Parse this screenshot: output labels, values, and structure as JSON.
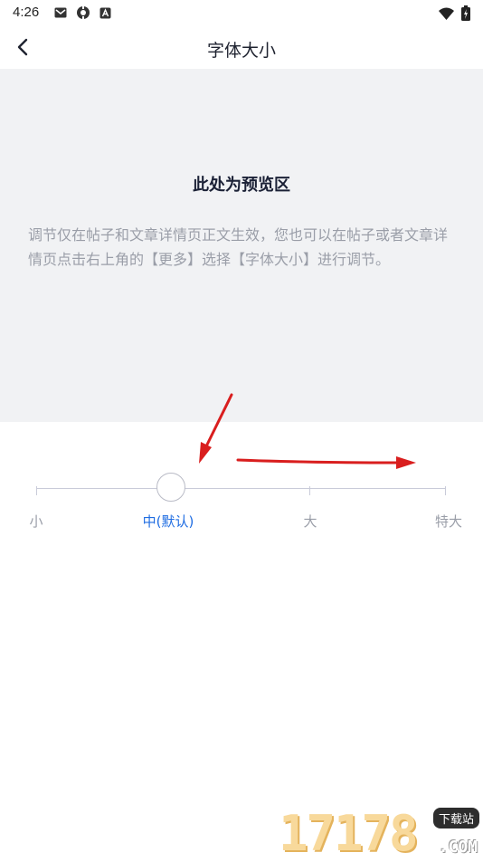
{
  "status_bar": {
    "time": "4:26",
    "left_icons": [
      "gmail-icon",
      "settings-shield-icon",
      "a-badge-icon"
    ],
    "right_icons": [
      "wifi-icon",
      "battery-charging-icon"
    ]
  },
  "app_bar": {
    "back_icon": "chevron-left-icon",
    "title": "字体大小"
  },
  "preview": {
    "heading": "此处为预览区",
    "body": "调节仅在帖子和文章详情页正文生效，您也可以在帖子或者文章详情页点击右上角的【更多】选择【字体大小】进行调节。"
  },
  "font_size_slider": {
    "options": [
      "小",
      "中(默认)",
      "大",
      "特大"
    ],
    "selected_index": 1,
    "active_color": "#1f6de2",
    "track_color": "#c9cbd9"
  },
  "annotation": {
    "arrow_color": "#d91e1e"
  },
  "watermark": {
    "number": "17178",
    "badge": "下载站",
    "domain": ".COM"
  }
}
